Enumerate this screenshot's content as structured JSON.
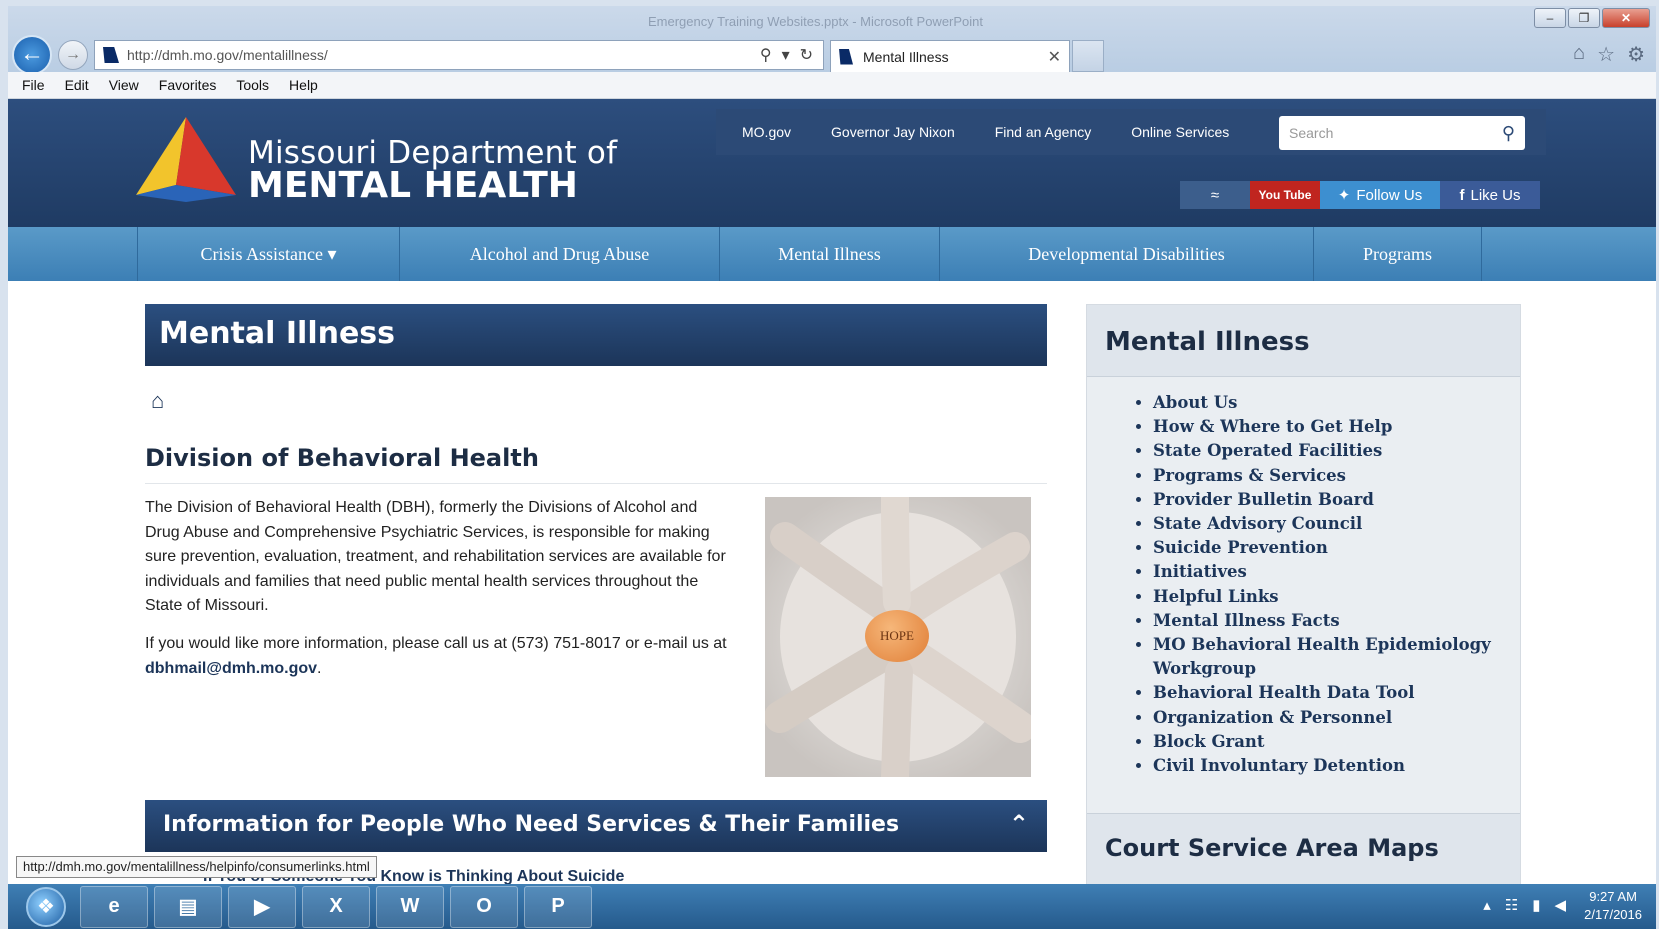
{
  "browser": {
    "window_title": "Emergency Training Websites.pptx - Microsoft PowerPoint",
    "window_buttons": [
      "–",
      "❐",
      "✕"
    ],
    "address": "http://dmh.mo.gov/mentalillness/",
    "tab_label": "Mental Illness",
    "menu": [
      "File",
      "Edit",
      "View",
      "Favorites",
      "Tools",
      "Help"
    ],
    "status_url": "http://dmh.mo.gov/mentalillness/helpinfo/consumerlinks.html"
  },
  "site": {
    "logo_line1": "Missouri Department of",
    "logo_line2": "MENTAL HEALTH",
    "util_nav": [
      "MO.gov",
      "Governor Jay Nixon",
      "Find an Agency",
      "Online Services"
    ],
    "search_placeholder": "Search",
    "social": {
      "rss": "☰",
      "youtube": "You Tube",
      "twitter": "Follow Us",
      "facebook": "Like Us"
    },
    "main_nav": [
      "Crisis Assistance ▾",
      "Alcohol and Drug Abuse",
      "Mental Illness",
      "Developmental Disabilities",
      "Programs"
    ]
  },
  "content": {
    "banner_title": "Mental Illness",
    "division_title": "Division of Behavioral Health",
    "paragraph1": "The Division of Behavioral Health (DBH), formerly the Divisions of Alcohol and Drug Abuse and Comprehensive Psychiatric Services, is responsible for making sure prevention, evaluation, treatment, and rehabilitation services are available for individuals and families that need public mental health services throughout the State of Missouri.",
    "paragraph2_prefix": "If you would like more information, please call us at (573) 751-8017 or e-mail us at ",
    "paragraph2_email": "dbhmail@dmh.mo.gov",
    "paragraph2_suffix": ".",
    "image_label": "HOPE",
    "info_bar_title": "Information for People Who Need Services & Their Families",
    "info_peek": "If You or Someone You Know is Thinking About Suicide"
  },
  "sidebar": {
    "title": "Mental Illness",
    "items": [
      "About Us",
      "How & Where to Get Help",
      "State Operated Facilities",
      "Programs & Services",
      "Provider Bulletin Board",
      "State Advisory Council",
      "Suicide Prevention",
      "Initiatives",
      "Helpful Links",
      "Mental Illness Facts",
      "MO Behavioral Health Epidemiology Workgroup",
      "Behavioral Health Data Tool",
      "Organization & Personnel",
      "Block Grant",
      "Civil Involuntary Detention"
    ],
    "maps_title": "Court Service Area Maps"
  },
  "taskbar": {
    "apps": [
      "e",
      "▤",
      "▶",
      "X",
      "W",
      "O",
      "P"
    ],
    "time": "9:27 AM",
    "date": "2/17/2016"
  },
  "colors": {
    "header": "#2d4e7e",
    "nav": "#4a8cc0",
    "accent": "#1c3559"
  }
}
